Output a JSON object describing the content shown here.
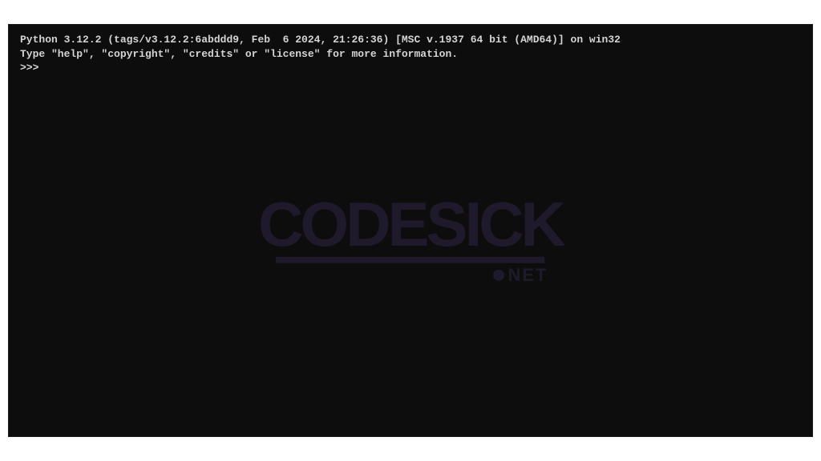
{
  "terminal": {
    "banner_line1": "Python 3.12.2 (tags/v3.12.2:6abddd9, Feb  6 2024, 21:26:36) [MSC v.1937 64 bit (AMD64)] on win32",
    "banner_line2": "Type \"help\", \"copyright\", \"credits\" or \"license\" for more information.",
    "prompt": ">>> ",
    "input_value": ""
  },
  "watermark": {
    "brand": "CODESICK",
    "suffix": "NET"
  }
}
